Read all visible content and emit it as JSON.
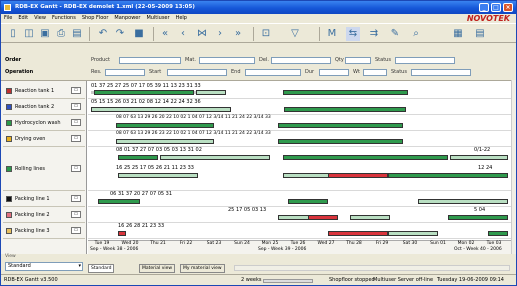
{
  "window": {
    "title": "RDB-EX Gantt - RDB-EX demolet 1.xml (22-05-2009 13:05)",
    "brand": "NOVOTEK"
  },
  "menu": [
    "File",
    "Edit",
    "View",
    "Functions",
    "Shop Floor",
    "Manpower",
    "Multiuser",
    "Help"
  ],
  "toolbar_icons": [
    "new-icon",
    "open-icon",
    "save-icon",
    "print-icon",
    "print-preview-icon",
    "undo-icon",
    "redo-icon",
    "stop-icon",
    "first-icon",
    "prev-icon",
    "center-icon",
    "next-icon",
    "last-icon",
    "zoom-icon",
    "filter-icon",
    "ms-icon",
    "view1-icon",
    "view2-icon",
    "search-icon",
    "chart-icon",
    "grid-icon"
  ],
  "filters": {
    "order": "Order",
    "product": "Product",
    "mat": "Mat.",
    "del": "Del.",
    "qty": "Qty",
    "status": "Status",
    "operation": "Operation",
    "res": "Res.",
    "start": "Start",
    "end": "End",
    "dur": "Dur",
    "wt": "Wt",
    "status2": "Status"
  },
  "rows": [
    {
      "name": "Reaction tank 1",
      "color": "#c03030"
    },
    {
      "name": "Reaction tank 2",
      "color": "#3050c0"
    },
    {
      "name": "Hydrocyclon wash",
      "color": "#2a9a4a"
    },
    {
      "name": "Drying oven",
      "color": "#e8b020"
    },
    {
      "name": "Rolling lines",
      "color": "#2a9a4a"
    },
    {
      "name": "Packing line 1",
      "color": "#101010"
    },
    {
      "name": "Packing line 2",
      "color": "#e07080"
    },
    {
      "name": "Packing line 3",
      "color": "#e8c060"
    }
  ],
  "row_numbers": [
    "01   37   25  27   25  07   17                  05   39   11   13   23   31   33",
    "05   15   15   26   03   21   02   08                  12   14   22   24   32   36",
    "08 07 63 13 29 26 20 22 10 02                  1 04 07 12 3/14 11 21 24 22 3/14 33",
    "08 07 63 13 29 26 23 22 10 02                  1 04 07 12 3/14 11 21 24 22 3/14 33",
    "08 01   37   27   07                   03   05   03   13   31   02",
    "16   25                 25                 17   05   26   21 11 23   33",
    "06   31        37   20  27                   07   05                       31",
    "                                      25        17   05        03        13",
    "           16                                          26   28   21 23       33"
  ],
  "rolling_extra": {
    "a": "0/1-22",
    "b": "12  24"
  },
  "pack2_extra": "5  04",
  "days": [
    "Tue 19",
    "Wed 20",
    "Thu 21",
    "Fri 22",
    "Sat 23",
    "Sun 24",
    "Mon 25",
    "Tue 26",
    "Wed 27",
    "Thu 28",
    "Fri 29",
    "Sat 30",
    "Sun 01",
    "Mon 02",
    "Tue 03"
  ],
  "weeks": [
    "Sep - Week 38 - 2006",
    "Sep - Week 39 - 2006",
    "Oct - Week 40 - 2006"
  ],
  "bottom": {
    "view_label": "View",
    "view_value": "Standard",
    "tabs": [
      "Standard",
      "Material view",
      "My material view"
    ]
  },
  "status": {
    "version": "RDB-EX Gantt v3.500",
    "weeks": "2 weeks",
    "shopfloor": "Shopfloor stopped",
    "multiuser": "Multiuser Server off-line",
    "datetime": "Tuesday 19-06-2009 09:14"
  }
}
